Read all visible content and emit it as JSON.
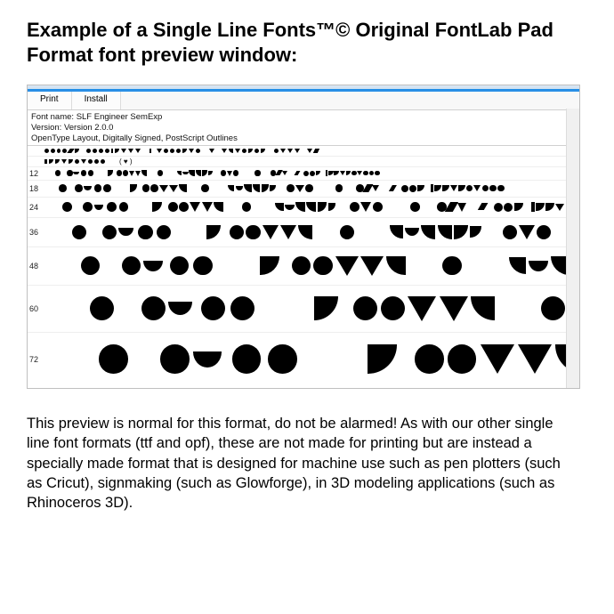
{
  "heading": "Example of a Single Line Fonts™© Original FontLab Pad Format font preview window:",
  "toolbar": {
    "print": "Print",
    "install": "Install"
  },
  "meta": {
    "line1": "Font name: SLF Engineer SemExp",
    "line2": "Version: Version 2.0.0",
    "line3": "OpenType Layout, Digitally Signed, PostScript Outlines"
  },
  "sizes": [
    "12",
    "18",
    "24",
    "36",
    "48",
    "60",
    "72"
  ],
  "description": "This preview is normal for this format, do not be alarmed!  As with our other single line font formats (ttf and opf), these are not made for printing but are instead a specially made format that is designed for machine use such as pen plotters (such as Cricut), signmaking  (such as Glowforge), in 3D modeling applications (such as Rhinoceros 3D)."
}
